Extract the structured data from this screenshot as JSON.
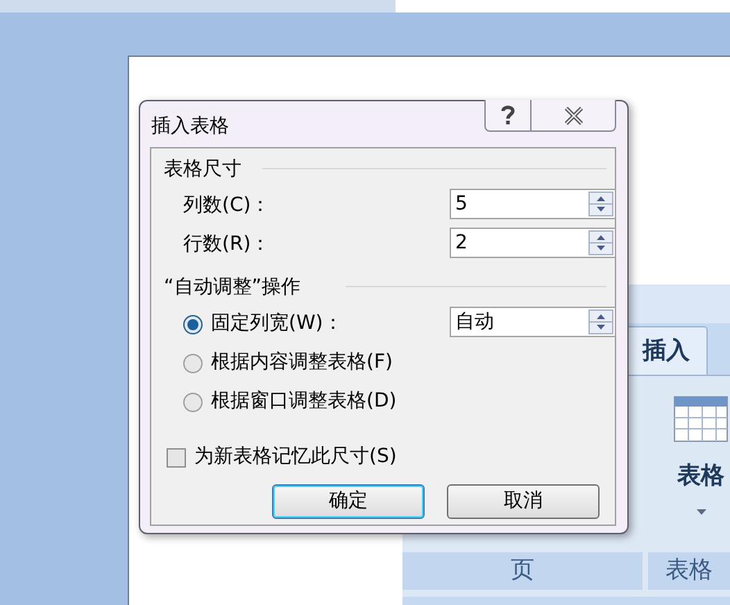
{
  "dialog": {
    "title": "插入表格",
    "size_section": {
      "title": "表格尺寸",
      "fields": [
        {
          "label": "列数(C)：",
          "value": "5"
        },
        {
          "label": "行数(R)：",
          "value": "2"
        }
      ]
    },
    "autofit_section": {
      "title": "“自动调整”操作",
      "options": [
        {
          "label": "固定列宽(W)：",
          "selected": true,
          "value": "自动"
        },
        {
          "label": "根据内容调整表格(F)",
          "selected": false
        },
        {
          "label": "根据窗口调整表格(D)",
          "selected": false
        }
      ]
    },
    "remember": {
      "label": "为新表格记忆此尺寸(S)",
      "checked": false
    },
    "buttons": [
      {
        "label": "确定",
        "default": true
      },
      {
        "label": "取消",
        "default": false
      }
    ]
  },
  "ribbon": {
    "tab": "插入",
    "groups": [
      {
        "label": "页"
      },
      {
        "label": "表格",
        "button": "表格"
      }
    ]
  }
}
